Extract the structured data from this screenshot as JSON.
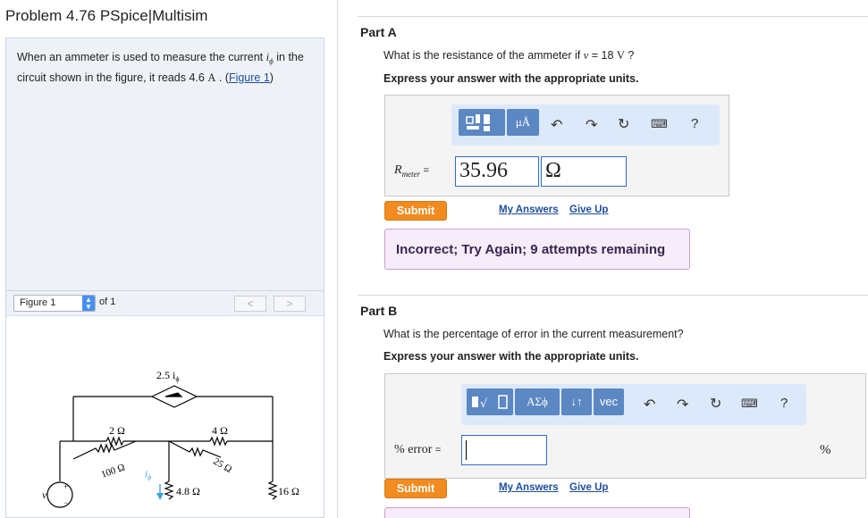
{
  "problem": {
    "title": "Problem 4.76 PSpice|Multisim",
    "text_before": "When an ammeter is used to measure the current ",
    "current_symbol": "i",
    "current_sub": "ϕ",
    "text_middle": " in the circuit shown in the figure, it reads 4.6 ",
    "unit": "A",
    "text_after": " . (",
    "figure_link": "Figure 1",
    "text_close": ")"
  },
  "figure": {
    "select_value": "Figure 1",
    "of_label": "of 1",
    "prev_label": "<",
    "next_label": ">",
    "circuit": {
      "dep_source": "2.5 i",
      "dep_source_sub": "ϕ",
      "r1": "2 Ω",
      "r2": "4 Ω",
      "r3": "100 Ω",
      "r4": "4.8 Ω",
      "r5": "25 Ω",
      "r6": "16 Ω",
      "source": "v",
      "current": "i",
      "current_sub": "ϕ",
      "plus": "+",
      "minus": "−"
    }
  },
  "partA": {
    "label": "Part A",
    "question_before": "What is the resistance of the ammeter if ",
    "var": "v",
    "question_after": " = 18 ",
    "question_unit": "V",
    "question_end": " ?",
    "express": "Express your answer with the appropriate units.",
    "toolbar": {
      "units_btn": "μÅ",
      "help": "?"
    },
    "var_label": "R",
    "var_sub": "meter",
    "equals": "=",
    "value": "35.96",
    "unit_value": "Ω",
    "submit": "Submit",
    "my_answers": "My Answers",
    "give_up": "Give Up",
    "feedback": "Incorrect; Try Again; 9 attempts remaining"
  },
  "partB": {
    "label": "Part B",
    "question": "What is the percentage of error in the current measurement?",
    "express": "Express your answer with the appropriate units.",
    "toolbar": {
      "greek_btn": "ΑΣϕ",
      "arrows_btn": "↓↑",
      "vec_btn": "vec",
      "help": "?"
    },
    "var_label": "% error",
    "equals": "=",
    "value": "",
    "unit_value": "%",
    "submit": "Submit",
    "my_answers": "My Answers",
    "give_up": "Give Up"
  },
  "colors": {
    "accent": "#f28b20",
    "toolbar_button": "#5b87c2",
    "link": "#1f4e9c",
    "feedback_bg": "#f7ecf9"
  }
}
